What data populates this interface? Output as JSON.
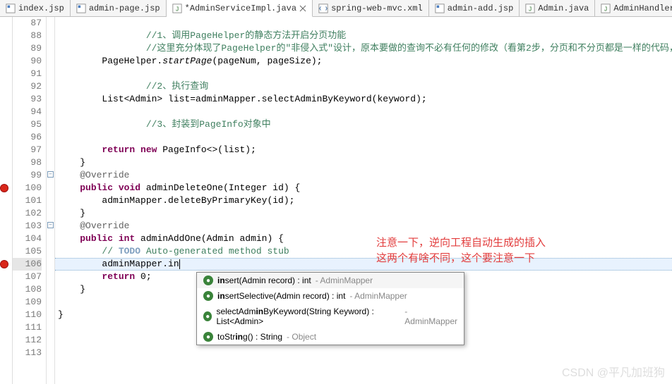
{
  "tabs": [
    {
      "label": "index.jsp",
      "icon": "jsp"
    },
    {
      "label": "admin-page.jsp",
      "icon": "jsp"
    },
    {
      "label": "*AdminServiceImpl.java",
      "icon": "java-class",
      "active": true,
      "dirty": true
    },
    {
      "label": "spring-web-mvc.xml",
      "icon": "xml"
    },
    {
      "label": "admin-add.jsp",
      "icon": "jsp"
    },
    {
      "label": "Admin.java",
      "icon": "java-class"
    },
    {
      "label": "AdminHandler",
      "icon": "java-class"
    }
  ],
  "lines": {
    "87": "",
    "88": "        //1、调用PageHelper的静态方法开启分页功能",
    "89": "        //这里充分体现了PageHelper的\"非侵入式\"设计，原本要做的查询不必有任何的修改（看第2步，分页和不分页都是一样的代码，完全没有任何",
    "90": "        PageHelper.startPage(pageNum, pageSize);",
    "91": "",
    "92": "        //2、执行查询",
    "93": "        List<Admin> list=adminMapper.selectAdminByKeyword(keyword);",
    "94": "",
    "95": "        //3、封装到PageInfo对象中",
    "96": "",
    "97": "        return new PageInfo<>(list);",
    "98": "    }",
    "99": "    @Override",
    "100": "    public void adminDeleteOne(Integer id) {",
    "101": "        adminMapper.deleteByPrimaryKey(id);",
    "102": "    }",
    "103": "    @Override",
    "104": "    public int adminAddOne(Admin admin) {",
    "105": "        // TODO Auto-generated method stub",
    "106": "        adminMapper.in",
    "107": "        return 0;",
    "108": "    }",
    "109": "",
    "110": "}",
    "111": "",
    "112": "",
    "113": ""
  },
  "annotation": {
    "line1": "注意一下，逆向工程自动生成的插入",
    "line2": "这两个有啥不同，这个要注意一下"
  },
  "popup": {
    "items": [
      {
        "prefix": "in",
        "rest": "sert(Admin record) : int",
        "tail": " - AdminMapper",
        "kind": "method"
      },
      {
        "prefix": "in",
        "rest": "sertSelective(Admin record) : int",
        "tail": " - AdminMapper",
        "kind": "method"
      },
      {
        "prefix": "",
        "rest": "selectAdm",
        "mid": "in",
        "rest2": "ByKeyword(String Keyword) : List<Admin>",
        "tail": " - AdminMapper",
        "kind": "method"
      },
      {
        "prefix": "",
        "rest": "toStr",
        "mid": "in",
        "rest2": "g() : String",
        "tail": " - Object",
        "kind": "method"
      }
    ]
  },
  "watermark": "CSDN @平凡加班狗"
}
